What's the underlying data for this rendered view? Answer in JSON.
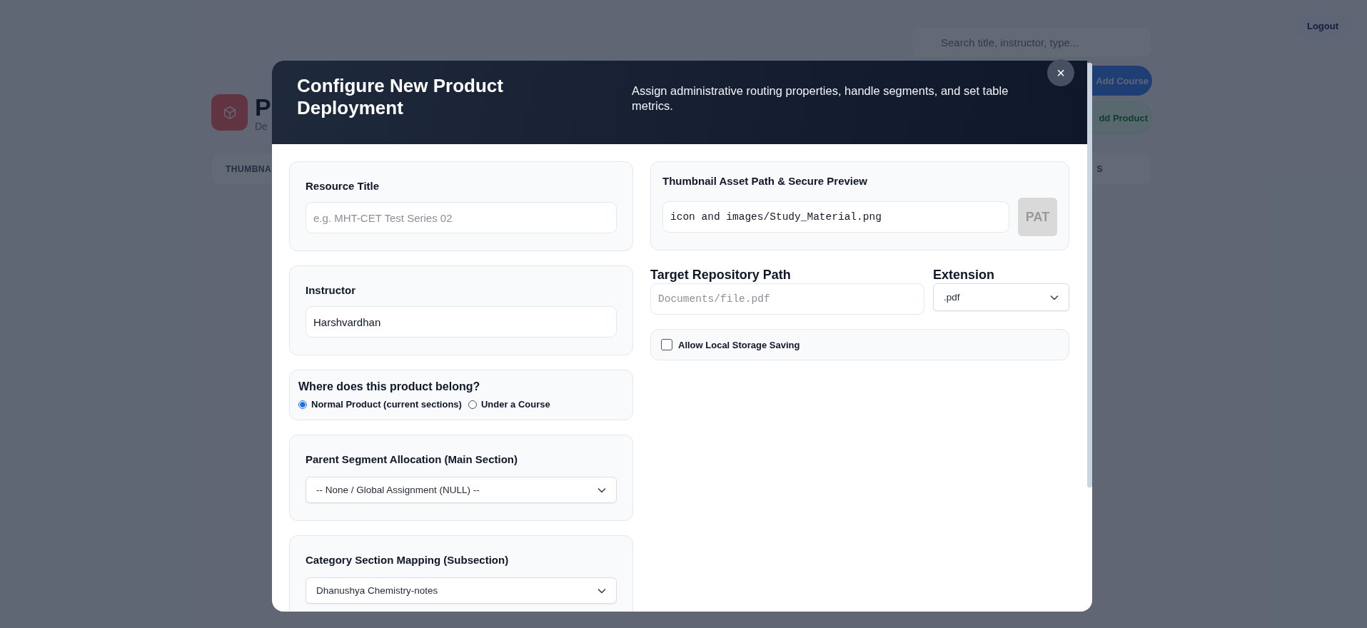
{
  "background": {
    "logout": "Logout",
    "search_placeholder": "Search title, instructor, type...",
    "page_title": "P",
    "page_subtitle": "De",
    "buttons": [
      {
        "label": "Add Course",
        "kind": "primary"
      },
      {
        "label": "dd Product",
        "kind": "secondary"
      }
    ],
    "table_header": [
      "THUMBNA",
      "S"
    ]
  },
  "modal": {
    "title": "Configure New Product Deployment",
    "subtitle": "Assign administrative routing properties, handle segments, and set table metrics.",
    "close": "×",
    "resource_title": {
      "label": "Resource Title",
      "placeholder": "e.g. MHT-CET Test Series 02"
    },
    "instructor": {
      "label": "Instructor",
      "value": "Harshvardhan"
    },
    "belong": {
      "question": "Where does this product belong?",
      "options": [
        {
          "label": "Normal Product (current sections)",
          "selected": true
        },
        {
          "label": "Under a Course",
          "selected": false
        }
      ]
    },
    "parent_segment": {
      "label": "Parent Segment Allocation (Main Section)",
      "value": "-- None / Global Assignment (NULL) --"
    },
    "category_section": {
      "label": "Category Section Mapping (Subsection)",
      "value": "Dhanushya Chemistry-notes"
    },
    "thumbnail": {
      "label": "Thumbnail Asset Path & Secure Preview",
      "value": "icon and images/Study_Material.png",
      "preview": "PAT"
    },
    "repository": {
      "label": "Target Repository Path",
      "placeholder": "Documents/file.pdf"
    },
    "extension": {
      "label": "Extension",
      "value": ".pdf"
    },
    "local_storage": {
      "label": "Allow Local Storage Saving",
      "checked": false
    }
  }
}
